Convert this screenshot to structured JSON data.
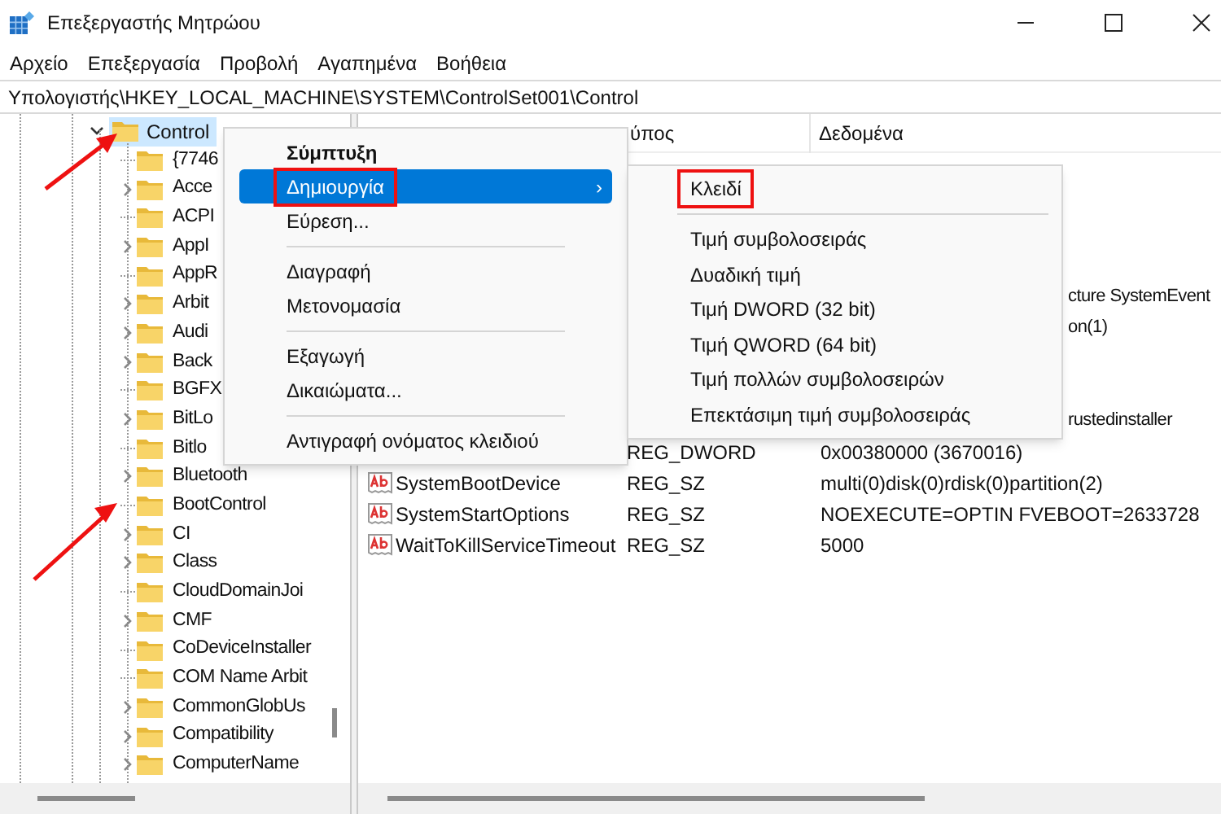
{
  "window": {
    "title": "Επεξεργαστής Μητρώου"
  },
  "menu_bar": [
    "Αρχείο",
    "Επεξεργασία",
    "Προβολή",
    "Αγαπημένα",
    "Βοήθεια"
  ],
  "address": "Υπολογιστής\\HKEY_LOCAL_MACHINE\\SYSTEM\\ControlSet001\\Control",
  "tree": {
    "label": "Control",
    "expanded": true,
    "selected": true,
    "children": [
      {
        "label": "{7746",
        "has_children": false
      },
      {
        "label": "Acce",
        "has_children": true
      },
      {
        "label": "ACPI",
        "has_children": false
      },
      {
        "label": "AppI",
        "has_children": true
      },
      {
        "label": "AppR",
        "has_children": false
      },
      {
        "label": "Arbit",
        "has_children": true
      },
      {
        "label": "Audi",
        "has_children": true
      },
      {
        "label": "Back",
        "has_children": true
      },
      {
        "label": "BGFX",
        "has_children": false
      },
      {
        "label": "BitLo",
        "has_children": true
      },
      {
        "label": "Bitlo",
        "has_children": false
      },
      {
        "label": "Bluetooth",
        "has_children": true
      },
      {
        "label": "BootControl",
        "has_children": false
      },
      {
        "label": "CI",
        "has_children": true
      },
      {
        "label": "Class",
        "has_children": true
      },
      {
        "label": "CloudDomainJoi",
        "has_children": false
      },
      {
        "label": "CMF",
        "has_children": true
      },
      {
        "label": "CoDeviceInstaller",
        "has_children": false
      },
      {
        "label": "COM Name Arbit",
        "has_children": false
      },
      {
        "label": "CommonGlobUs",
        "has_children": true
      },
      {
        "label": "Compatibility",
        "has_children": true
      },
      {
        "label": "ComputerName",
        "has_children": true
      }
    ]
  },
  "table": {
    "columns": [
      "ύπος",
      "Δεδομένα"
    ],
    "rows": [
      {
        "kind": "partial",
        "data": "cture SystemEvent"
      },
      {
        "kind": "partial",
        "data": "on(1)"
      },
      {
        "kind": "partial",
        "data": "rustedinstaller"
      },
      {
        "kind": "type_data",
        "type": "REG_DWORD",
        "data": "0x00380000 (3670016)"
      },
      {
        "kind": "full",
        "name": "SystemBootDevice",
        "type": "REG_SZ",
        "data": "multi(0)disk(0)rdisk(0)partition(2)"
      },
      {
        "kind": "full",
        "name": "SystemStartOptions",
        "type": "REG_SZ",
        "data": " NOEXECUTE=OPTIN  FVEBOOT=2633728"
      },
      {
        "kind": "full",
        "name": "WaitToKillServiceTimeout",
        "type": "REG_SZ",
        "data": "5000"
      }
    ]
  },
  "context_menu": {
    "items": [
      {
        "kind": "item",
        "label": "Σύμπτυξη",
        "bold": true,
        "selected": false,
        "submenu": false,
        "highlighted_box": false
      },
      {
        "kind": "item",
        "label": "Δημιουργία",
        "bold": false,
        "selected": true,
        "submenu": true,
        "highlighted_box": true
      },
      {
        "kind": "item",
        "label": "Εύρεση...",
        "bold": false,
        "selected": false,
        "submenu": false,
        "highlighted_box": false
      },
      {
        "kind": "separator"
      },
      {
        "kind": "item",
        "label": "Διαγραφή",
        "bold": false,
        "selected": false,
        "submenu": false,
        "highlighted_box": false
      },
      {
        "kind": "item",
        "label": "Μετονομασία",
        "bold": false,
        "selected": false,
        "submenu": false,
        "highlighted_box": false
      },
      {
        "kind": "separator"
      },
      {
        "kind": "item",
        "label": "Εξαγωγή",
        "bold": false,
        "selected": false,
        "submenu": false,
        "highlighted_box": false
      },
      {
        "kind": "item",
        "label": "Δικαιώματα...",
        "bold": false,
        "selected": false,
        "submenu": false,
        "highlighted_box": false
      },
      {
        "kind": "separator"
      },
      {
        "kind": "item",
        "label": "Αντιγραφή ονόματος κλειδιού",
        "bold": false,
        "selected": false,
        "submenu": false,
        "highlighted_box": false
      }
    ],
    "submenu_arrow": "›"
  },
  "submenu": {
    "items": [
      {
        "kind": "item",
        "label": "Κλειδί",
        "highlighted_box": true
      },
      {
        "kind": "separator"
      },
      {
        "kind": "item",
        "label": "Τιμή συμβολοσειράς",
        "highlighted_box": false
      },
      {
        "kind": "item",
        "label": "Δυαδική τιμή",
        "highlighted_box": false
      },
      {
        "kind": "item",
        "label": "Τιμή DWORD (32 bit)",
        "highlighted_box": false
      },
      {
        "kind": "item",
        "label": "Τιμή QWORD (64 bit)",
        "highlighted_box": false
      },
      {
        "kind": "item",
        "label": "Τιμή πολλών συμβολοσειρών",
        "highlighted_box": false
      },
      {
        "kind": "item",
        "label": "Επεκτάσιμη τιμή συμβολοσειράς",
        "highlighted_box": false
      }
    ]
  }
}
